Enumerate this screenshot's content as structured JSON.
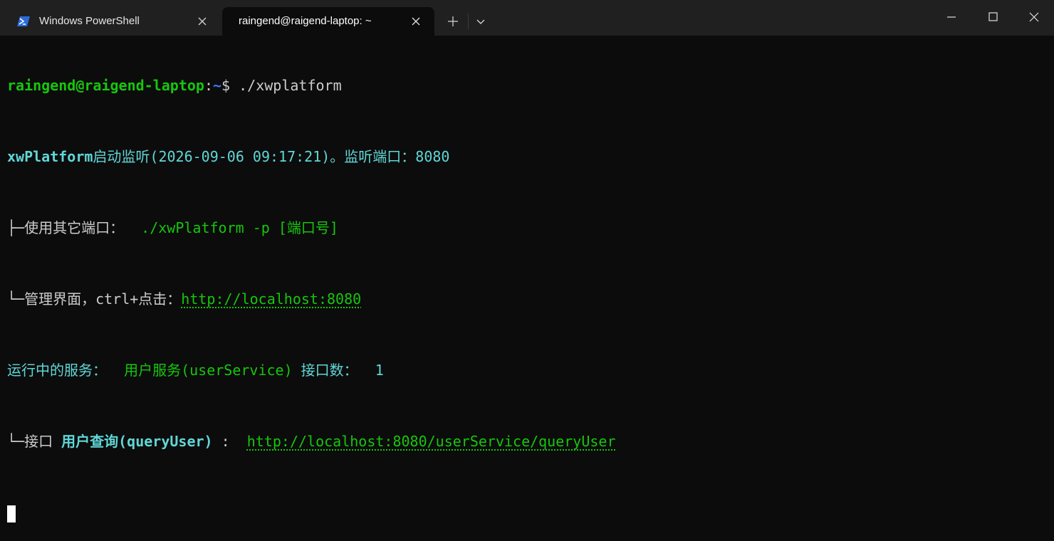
{
  "tabs": [
    {
      "label": "Windows PowerShell",
      "icon": "powershell-icon",
      "active": false
    },
    {
      "label": "raingend@raigend-laptop: ~",
      "icon": "",
      "active": true
    }
  ],
  "colors": {
    "prompt_green": "#16c60c",
    "cyan": "#61d6d6",
    "path_blue": "#3b78ff",
    "text": "#cccccc",
    "background": "#0c0c0c",
    "titlebar": "#202020"
  },
  "terminal": {
    "prompt": {
      "user_host": "raingend@raigend-laptop",
      "sep": ":",
      "path": "~",
      "symbol": "$ ",
      "command": "./xwplatform"
    },
    "line2": {
      "app": "xwPlatform",
      "text": "启动监听(2026-09-06 09:17:21)。监听端口：8080"
    },
    "line3": {
      "prefix": "├─使用其它端口：  ",
      "value": "./xwPlatform -p [端口号]"
    },
    "line4": {
      "prefix": "└─管理界面，ctrl+点击：",
      "link": "http://localhost:8080"
    },
    "line5": {
      "label": "运行中的服务：  ",
      "service": "用户服务(userService)",
      "count_label": " 接口数：  ",
      "count": "1"
    },
    "line6": {
      "prefix": "└─接口 ",
      "api_name": "用户查询(queryUser)",
      "sep": " :  ",
      "link": "http://localhost:8080/userService/queryUser"
    }
  }
}
